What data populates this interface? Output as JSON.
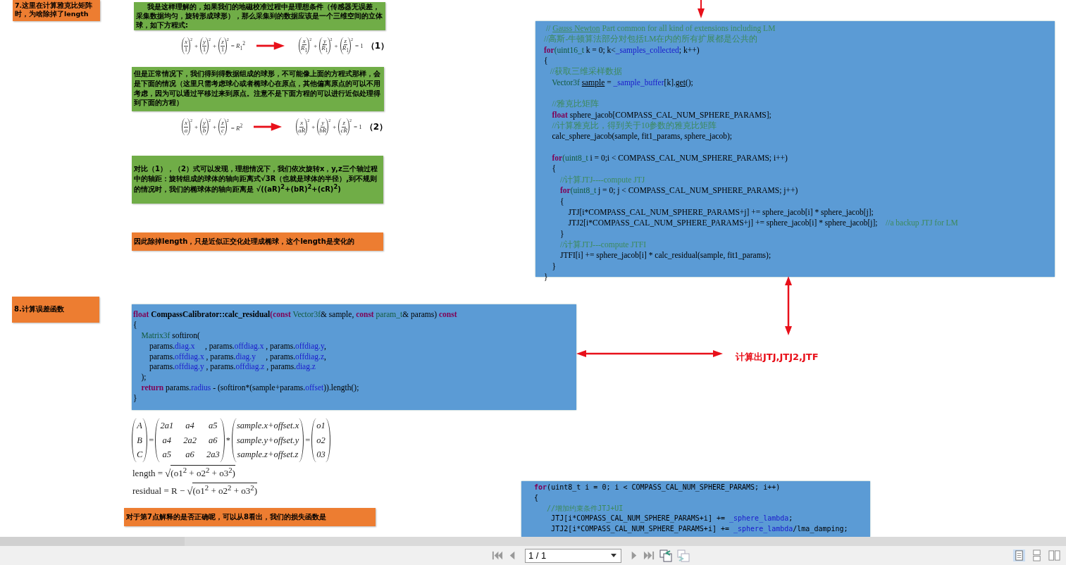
{
  "notes": [
    {
      "kind": "heading",
      "text": "7.这里在计算雅克比矩阵时，为啥除掉了length"
    },
    {
      "kind": "explanation",
      "text": "我是这样理解的，如果我们的地磁校准过程中是理想条件（传感器无误差，采集数据均匀，旋转形成球形），那么采集到的数据应该是一个三维空间的立体球，如下方程式:"
    },
    {
      "kind": "explanation",
      "text": "但是正常情况下，我们得到得数据组成的球形，不可能像上面的方程式那样，会是下面的情况（这里只需考虑球心或者椭球心在原点，其他偏离原点的可以不用考虑，因为可以通过平移过来到原点。注意不是下面方程的可以进行近似处理得到下面的方程）"
    },
    {
      "kind": "explanation",
      "text": "对比（1），（2）式可以发现，理想情况下，我们依次旋转x，y,z三个轴过程中的轴距：旋转组成的球体的轴向距离式√3R（也就是球体的半径）,到不规则的情况时，我们的椭球体的轴向距离是 √((aR)$^{2}$+(bR)$^{2}$+(cR)$^{2}$)"
    },
    {
      "kind": "heading",
      "text": "因此除掉length，只是近似正交化处理成椭球，这个length是变化的"
    },
    {
      "kind": "heading",
      "text": "8.计算误差函数"
    },
    {
      "kind": "heading",
      "text": "对于第7点解释的是否正确呢，可以从8看出，我们的损失函数是"
    }
  ],
  "equations": [
    {
      "left": {
        "joiner": "+",
        "terms": [
          {
            "num": "*x*",
            "den": "1",
            "power": "2"
          },
          {
            "num": "*y*",
            "den": "1",
            "power": "2"
          },
          {
            "num": "*z*",
            "den": "1",
            "power": "2"
          }
        ],
        "rhs": "= *R*$_{1}$$^{2}$"
      },
      "right": {
        "joiner": "+",
        "terms": [
          {
            "num": "*x*",
            "den": "*R*$_{1}$",
            "power": "2"
          },
          {
            "num": "*y*",
            "den": "*R*$_{1}$",
            "power": "2"
          },
          {
            "num": "*z*",
            "den": "*R*$_{1}$",
            "power": "2"
          }
        ],
        "rhs": "= 1"
      },
      "label": "（1）"
    },
    {
      "left": {
        "joiner": "+",
        "terms": [
          {
            "num": "*x*",
            "den": "*a*",
            "power": "2"
          },
          {
            "num": "*y*",
            "den": "*b*",
            "power": "2"
          },
          {
            "num": "*z*",
            "den": "*c*",
            "power": "2"
          }
        ],
        "rhs": "= *R*$^{2}$"
      },
      "right": {
        "joiner": "+",
        "terms": [
          {
            "num": "*x*",
            "den": "*aR*",
            "power": "2"
          },
          {
            "num": "*y*",
            "den": "*bR*",
            "power": "2"
          },
          {
            "num": "*z*",
            "den": "*cR*",
            "power": "2"
          }
        ],
        "rhs": "= 1"
      },
      "label": "（2）"
    }
  ],
  "matrix_equation": [
    {
      "kind": "matrix",
      "rows": [
        [
          "A"
        ],
        [
          "B"
        ],
        [
          "C"
        ]
      ]
    },
    {
      "kind": "op",
      "text": "="
    },
    {
      "kind": "matrix",
      "rows": [
        [
          "2a1",
          "a4",
          "a5"
        ],
        [
          "a4",
          "2a2",
          "a6"
        ],
        [
          "a5",
          "a6",
          "2a3"
        ]
      ]
    },
    {
      "kind": "op",
      "text": "*"
    },
    {
      "kind": "matrix",
      "rows": [
        [
          "sample.x+offset.x"
        ],
        [
          "sample.y+offset.y"
        ],
        [
          "sample.z+offset.z"
        ]
      ]
    },
    {
      "kind": "op",
      "text": "="
    },
    {
      "kind": "matrix",
      "rows": [
        [
          "o1"
        ],
        [
          "o2"
        ],
        [
          "03"
        ]
      ]
    }
  ],
  "formulas": [
    {
      "lhs": "length =",
      "radical": "√",
      "radicand": "(o1$^{2}$ + o2$^{2}$ + o3$^{2}$)"
    },
    {
      "lhs": "residual = R −",
      "radical": "√",
      "radicand": "(o1$^{2}$ + o2$^{2}$ + o3$^{2}$)"
    }
  ],
  "code_blocks": [
    {
      "lines": [
        {
          "kind": "code",
          "tokens": [
            {
              "kind": "comment",
              "text": " // "
            },
            {
              "kind": "comment-underlined",
              "text": "Gauss"
            },
            {
              "kind": "comment-underlined",
              "text": " Newton"
            },
            {
              "kind": "comment",
              "text": " Part common for all kind of extensions including LM"
            }
          ]
        },
        {
          "kind": "code",
          "tokens": [
            {
              "kind": "comment",
              "text": "//高斯-牛顿算法部分对包括LM在内的所有扩展都是公共的"
            }
          ]
        },
        {
          "kind": "code",
          "tokens": [
            {
              "kind": "keyword",
              "text": "for"
            },
            {
              "kind": "type",
              "text": "(uint16_t"
            },
            {
              "kind": "plain",
              "text": " k = 0; k<"
            },
            {
              "kind": "member",
              "text": "_samples_collected"
            },
            {
              "kind": "plain",
              "text": "; k++)"
            }
          ]
        },
        {
          "kind": "code",
          "tokens": [
            {
              "kind": "plain",
              "text": "{"
            }
          ]
        },
        {
          "kind": "code",
          "tokens": [
            {
              "kind": "comment",
              "text": "   //获取三维采样数据"
            }
          ]
        },
        {
          "kind": "code",
          "tokens": [
            {
              "kind": "type",
              "text": "    Vector3f "
            },
            {
              "kind": "plain-underlined",
              "text": "sample"
            },
            {
              "kind": "plain",
              "text": " = "
            },
            {
              "kind": "member",
              "text": "_sample_buffer"
            },
            {
              "kind": "plain",
              "text": "[k]."
            },
            {
              "kind": "plain-underlined",
              "text": "get"
            },
            {
              "kind": "plain",
              "text": "();"
            }
          ]
        },
        {
          "kind": "blank"
        },
        {
          "kind": "code",
          "tokens": [
            {
              "kind": "comment",
              "text": "    //雅克比矩阵"
            }
          ]
        },
        {
          "kind": "code",
          "tokens": [
            {
              "kind": "keyword",
              "text": "    float"
            },
            {
              "kind": "plain",
              "text": " sphere_jacob[COMPASS_CAL_NUM_SPHERE_PARAMS];"
            }
          ]
        },
        {
          "kind": "code",
          "tokens": [
            {
              "kind": "comment",
              "text": "    //计算雅克比，得到关于10参数的雅克比矩阵"
            }
          ]
        },
        {
          "kind": "code",
          "tokens": [
            {
              "kind": "plain",
              "text": "    calc_sphere_jacob(sample, fit1_params, sphere_jacob);"
            }
          ]
        },
        {
          "kind": "blank"
        },
        {
          "kind": "code",
          "tokens": [
            {
              "kind": "keyword",
              "text": "    for"
            },
            {
              "kind": "type",
              "text": "(uint8_t"
            },
            {
              "kind": "plain",
              "text": " i = 0;i < COMPASS_CAL_NUM_SPHERE_PARAMS; i++)"
            }
          ]
        },
        {
          "kind": "code",
          "tokens": [
            {
              "kind": "plain",
              "text": "    {"
            }
          ]
        },
        {
          "kind": "code",
          "tokens": [
            {
              "kind": "comment",
              "text": "        //计算JTJ----compute JTJ"
            }
          ]
        },
        {
          "kind": "code",
          "tokens": [
            {
              "kind": "keyword",
              "text": "        for"
            },
            {
              "kind": "type",
              "text": "(uint8_t"
            },
            {
              "kind": "plain",
              "text": " j = 0; j < COMPASS_CAL_NUM_SPHERE_PARAMS; j++)"
            }
          ]
        },
        {
          "kind": "code",
          "tokens": [
            {
              "kind": "plain",
              "text": "        {"
            }
          ]
        },
        {
          "kind": "code",
          "tokens": [
            {
              "kind": "plain",
              "text": "            JTJ[i*COMPASS_CAL_NUM_SPHERE_PARAMS+j] += sphere_jacob[i] * sphere_jacob[j];"
            }
          ]
        },
        {
          "kind": "code",
          "tokens": [
            {
              "kind": "plain",
              "text": "            JTJ2[i*COMPASS_CAL_NUM_SPHERE_PARAMS+j] += sphere_jacob[i] * sphere_jacob[j];    "
            },
            {
              "kind": "comment",
              "text": "//a backup JTJ for LM"
            }
          ]
        },
        {
          "kind": "code",
          "tokens": [
            {
              "kind": "plain",
              "text": "        }"
            }
          ]
        },
        {
          "kind": "code",
          "tokens": [
            {
              "kind": "comment",
              "text": "        //计算JTJ---compute JTFI"
            }
          ]
        },
        {
          "kind": "code",
          "tokens": [
            {
              "kind": "plain",
              "text": "        JTFI[i] += sphere_jacob[i] * calc_residual(sample, fit1_params);"
            }
          ]
        },
        {
          "kind": "code",
          "tokens": [
            {
              "kind": "plain",
              "text": "    }"
            }
          ]
        },
        {
          "kind": "code",
          "tokens": [
            {
              "kind": "plain",
              "text": "}"
            }
          ]
        }
      ]
    },
    {
      "lines": [
        {
          "kind": "code",
          "tokens": [
            {
              "kind": "keyword",
              "text": "float "
            },
            {
              "kind": "bold",
              "text": "CompassCalibrator::calc_residual"
            },
            {
              "kind": "keyword",
              "text": "(const"
            },
            {
              "kind": "type",
              "text": " Vector3f"
            },
            {
              "kind": "plain",
              "text": "& sample, "
            },
            {
              "kind": "keyword",
              "text": "const"
            },
            {
              "kind": "type",
              "text": " param_t"
            },
            {
              "kind": "plain",
              "text": "& params) "
            },
            {
              "kind": "keyword",
              "text": "const"
            }
          ]
        },
        {
          "kind": "code",
          "tokens": [
            {
              "kind": "plain",
              "text": "{"
            }
          ]
        },
        {
          "kind": "code",
          "tokens": [
            {
              "kind": "type",
              "text": "    Matrix3f"
            },
            {
              "kind": "plain",
              "text": " softiron("
            }
          ]
        },
        {
          "kind": "code",
          "tokens": [
            {
              "kind": "plain",
              "text": "        params."
            },
            {
              "kind": "member",
              "text": "diag.x"
            },
            {
              "kind": "plain",
              "text": "     , params."
            },
            {
              "kind": "member",
              "text": "offdiag.x"
            },
            {
              "kind": "plain",
              "text": " , params."
            },
            {
              "kind": "member",
              "text": "offdiag.y"
            },
            {
              "kind": "plain",
              "text": ","
            }
          ]
        },
        {
          "kind": "code",
          "tokens": [
            {
              "kind": "plain",
              "text": "        params."
            },
            {
              "kind": "member",
              "text": "offdiag.x"
            },
            {
              "kind": "plain",
              "text": " , params."
            },
            {
              "kind": "member",
              "text": "diag.y"
            },
            {
              "kind": "plain",
              "text": "     , params."
            },
            {
              "kind": "member",
              "text": "offdiag.z"
            },
            {
              "kind": "plain",
              "text": ","
            }
          ]
        },
        {
          "kind": "code",
          "tokens": [
            {
              "kind": "plain",
              "text": "        params."
            },
            {
              "kind": "member",
              "text": "offdiag.y"
            },
            {
              "kind": "plain",
              "text": " , params."
            },
            {
              "kind": "member",
              "text": "offdiag.z"
            },
            {
              "kind": "plain",
              "text": " , params."
            },
            {
              "kind": "member",
              "text": "diag.z"
            }
          ]
        },
        {
          "kind": "code",
          "tokens": [
            {
              "kind": "plain",
              "text": "    );"
            }
          ]
        },
        {
          "kind": "code",
          "tokens": [
            {
              "kind": "keyword",
              "text": "    return"
            },
            {
              "kind": "plain",
              "text": " params."
            },
            {
              "kind": "member",
              "text": "radius"
            },
            {
              "kind": "plain",
              "text": " - (softiron*(sample+params."
            },
            {
              "kind": "member",
              "text": "offset"
            },
            {
              "kind": "plain",
              "text": ")).length();"
            }
          ]
        },
        {
          "kind": "code",
          "tokens": [
            {
              "kind": "plain",
              "text": "}"
            }
          ]
        }
      ]
    },
    {
      "lines": [
        {
          "kind": "code",
          "tokens": [
            {
              "kind": "keyword",
              "text": "  for"
            },
            {
              "kind": "plain",
              "text": "(uint8_t i = 0; i < COMPASS_CAL_NUM_SPHERE_PARAMS; i++)"
            }
          ]
        },
        {
          "kind": "code",
          "tokens": [
            {
              "kind": "plain",
              "text": "  {"
            }
          ]
        },
        {
          "kind": "code",
          "tokens": [
            {
              "kind": "comment",
              "text": "     //增加约束条件JTJ+UI"
            }
          ]
        },
        {
          "kind": "code",
          "tokens": [
            {
              "kind": "plain",
              "text": "      JTJ[i*COMPASS_CAL_NUM_SPHERE_PARAMS+i] += "
            },
            {
              "kind": "member",
              "text": "_sphere_lambda"
            },
            {
              "kind": "plain",
              "text": ";"
            }
          ]
        },
        {
          "kind": "code",
          "tokens": [
            {
              "kind": "plain",
              "text": "      JTJ2[i*COMPASS_CAL_NUM_SPHERE_PARAMS+i] += "
            },
            {
              "kind": "member",
              "text": "_sphere_lambda"
            },
            {
              "kind": "plain",
              "text": "/lma_damping;"
            }
          ]
        }
      ]
    }
  ],
  "result_label": "计算出JTJ,JTJ2,JTF",
  "pager": {
    "page": "1 / 1"
  }
}
